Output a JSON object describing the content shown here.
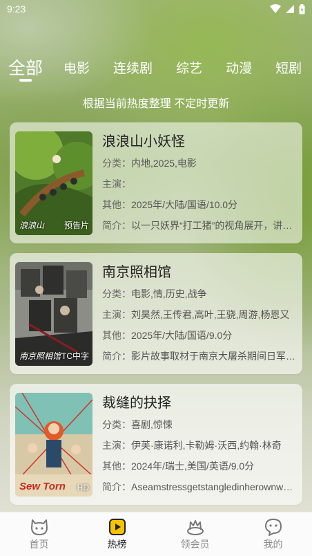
{
  "status": {
    "time": "9:23"
  },
  "tabs": [
    {
      "label": "全部"
    },
    {
      "label": "电影"
    },
    {
      "label": "连续剧"
    },
    {
      "label": "综艺"
    },
    {
      "label": "动漫"
    },
    {
      "label": "短剧"
    }
  ],
  "subtitle": "根据当前热度整理 不定时更新",
  "items": [
    {
      "title": "浪浪山小妖怪",
      "poster_badge": "预告片",
      "poster_script": "浪浪山",
      "category_label": "分类：",
      "category": "内地,2025,电影",
      "cast_label": "主演：",
      "cast": "",
      "other_label": "其他：",
      "other": "2025年/大陆/国语/10.0分",
      "intro_label": "简介：",
      "intro": "以一只妖界“打工猪”的视角展开，讲述了他"
    },
    {
      "title": "南京照相馆",
      "poster_badge": "TC中字",
      "poster_script": "南京照相馆",
      "category_label": "分类：",
      "category": "电影,情,历史,战争",
      "cast_label": "主演：",
      "cast": "刘昊然,王传君,高叶,王骁,周游,杨恩又",
      "other_label": "其他：",
      "other": "2025年/大陆/国语/9.0分",
      "intro_label": "简介：",
      "intro": "影片故事取材于南京大屠杀期间日军真实罪"
    },
    {
      "title": "裁缝的抉择",
      "poster_badge": "HD",
      "poster_script": "Sew Torn",
      "category_label": "分类：",
      "category": "喜剧,惊悚",
      "cast_label": "主演：",
      "cast": "伊芙·康诺利,卡勒姆·沃西,约翰·林奇",
      "other_label": "其他：",
      "other": "2024年/瑞士,美国/英语/9.0分",
      "intro_label": "简介：",
      "intro": "Aseamstressgetstangledinherownwebof"
    }
  ],
  "nav": [
    {
      "label": "首页",
      "icon": "cat-face-icon"
    },
    {
      "label": "热榜",
      "icon": "play-icon"
    },
    {
      "label": "领会员",
      "icon": "vip-crown-icon"
    },
    {
      "label": "我的",
      "icon": "chat-face-icon"
    }
  ],
  "colors": {
    "accent": "#f5c400",
    "text": "#222222"
  }
}
